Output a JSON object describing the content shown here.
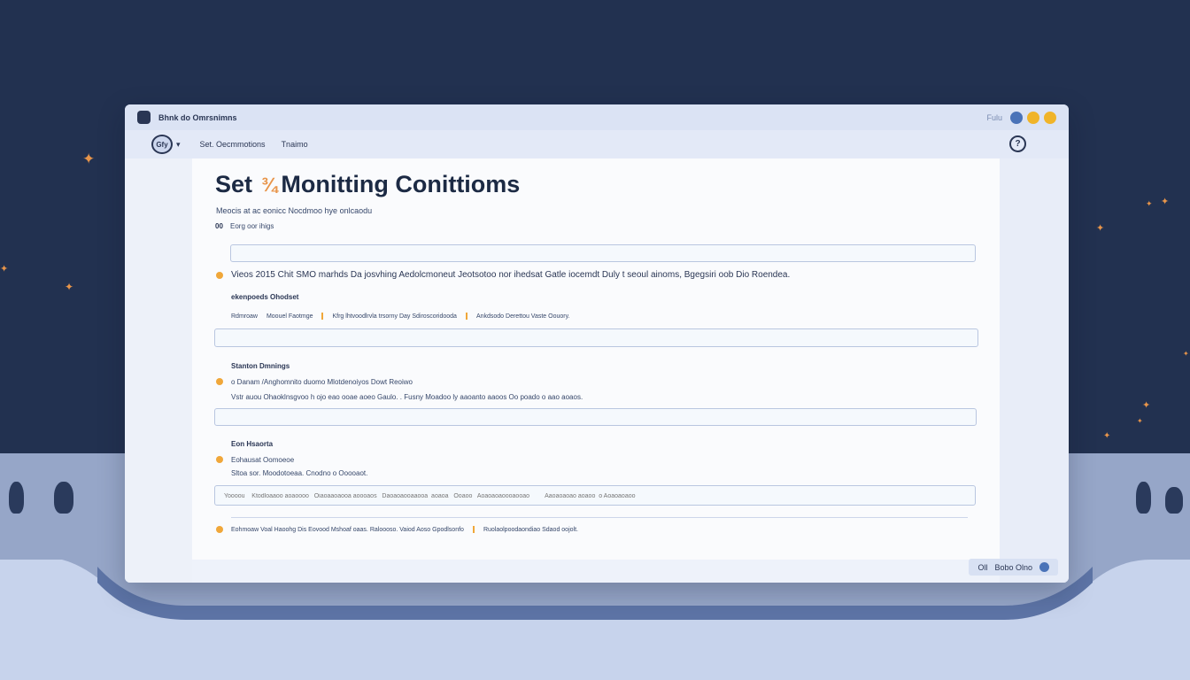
{
  "window": {
    "app_title": "Bhnk do Omrsnimns",
    "top_right_text": "Fulu",
    "dot_colors": [
      "#4a73b8",
      "#f0b429",
      "#f0b429"
    ]
  },
  "toolbar": {
    "logo_text": "Gfy",
    "logo_chevron": "▾",
    "items": [
      "Set. Oecmmotions",
      "Tnaimo"
    ],
    "help_label": "?"
  },
  "page": {
    "title_part1": "Set",
    "title_glyph": "¾",
    "title_part2": "Monitting Conittioms",
    "subtitle": "Meocis at ac eonicc Nocdmoo hye onlcaodu"
  },
  "section1": {
    "prefix": "00",
    "label": "Eorg oor ihigs",
    "field_placeholder": ""
  },
  "section2": {
    "description": "Vieos 2015  Chit  SMO  marhds  Da  josvhing Aedolcmoneut Jeotsotoo nor ihedsat  Gatle iocemdt Duly t seoul ainoms, Bgegsiri oob Dio Roendea.",
    "sublabel": "ekenpoeds Ohodset",
    "chips": [
      "Rdmroaw",
      "Moouel  Faotmge",
      "Kfrg lhtvoodlrvla trsorny  Day   Sdiroscoridooda",
      "Ankdsodo  Derettou  Vaste  Oouory."
    ],
    "field_placeholder": ""
  },
  "section3": {
    "title": "Stanton Dmnings",
    "line1": "o   Danam  /Anghomnito  duomo  Mlotdenoiyos  Dowt  Reoiwo",
    "line2": "Vstr auou   Ohaoklnsgvoo  h ojo eao ooae aoeo  Gaulo.  .  Fusny  Moadoo  ly  aaoanto aaoos  Oo poado o aao aoaos.",
    "field_placeholder": ""
  },
  "section4": {
    "title": "Eon Hsaorta",
    "line1": "Eohausat  Oomoeoe",
    "line2": "Sltoa sor.   Moodotoeaa.  Cnodno o Ooooaot.",
    "field_placeholder": "Yoooou    Ktodloaaoo aoaoooo   Oiaoaaoaooa aoooaos   Daoaoaooaaooa  aoaoa   Ooaoo   Aoaoaoaoooaooao         Aaoaoaoao aoaoo  o Aoaoaoaoo"
  },
  "section5": {
    "line": "Eohmoaw    Voal  Haoohg  Dis  Eovood  Mshoaf  oaas.   Raloooso.   Vaiod  Aoso Gpodlsonfo",
    "chip": "Ruolaolpoodaondiao Sdaod oojolt."
  },
  "footer": {
    "label1": "Oll",
    "label2": "Bobo  Olno"
  }
}
